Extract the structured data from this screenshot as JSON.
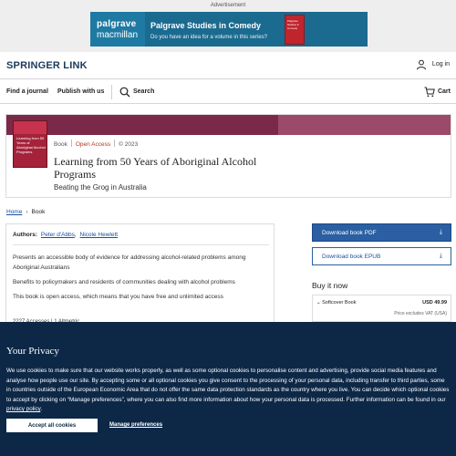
{
  "ad": {
    "label": "Advertisement",
    "brand_line1": "palgrave",
    "brand_line2": "macmillan",
    "title": "Palgrave Studies in Comedy",
    "subtitle": "Do you have an idea for a volume in this series?",
    "book_text": "Palgrave Studies in Comedy",
    "brand_color": "#1b6a8f"
  },
  "header": {
    "logo": "SPRINGER LINK",
    "login_label": "Log in",
    "login_icon": "user-icon"
  },
  "nav": {
    "find_journal": "Find a journal",
    "publish": "Publish with us",
    "search": "Search",
    "cart": "Cart"
  },
  "book": {
    "cover_text": "Learning from 50 Years of Aboriginal Alcohol Programs",
    "type": "Book",
    "access": "Open Access",
    "year": "© 2023",
    "title": "Learning from 50 Years of Aboriginal Alcohol Programs",
    "subtitle": "Beating the Grog in Australia",
    "accent_color": "#7a2a48"
  },
  "breadcrumb": {
    "home": "Home",
    "current": "Book"
  },
  "info": {
    "authors_label": "Authors:",
    "author1": "Peter d'Abbs",
    "author2": "Nicole Hewlett",
    "bullets": [
      "Presents an accessible body of evidence for addressing alcohol-related problems among Aboriginal Australians",
      "Benefits to policymakers and residents of communities dealing with alcohol problems",
      "This book is open access, which means that you have free and unlimited access"
    ],
    "more_text": "2227 Accesses  |  1 Altmetric"
  },
  "sidebar": {
    "download_pdf": "Download book PDF",
    "download_epub": "Download book EPUB",
    "buy_title": "Buy it now",
    "softcover_label": "Softcover Book",
    "softcover_price": "USD 49.99",
    "vat_note": "Price excludes VAT (USA)"
  },
  "privacy": {
    "title": "Your Privacy",
    "body": "We use cookies to make sure that our website works properly, as well as some optional cookies to personalise content and advertising, provide social media features and analyse how people use our site. By accepting some or all optional cookies you give consent to the processing of your personal data, including transfer to third parties, some in countries outside of the European Economic Area that do not offer the same data protection standards as the country where you live. You can decide which optional cookies to accept by clicking on “Manage preferences”, where you can also find more information about how your personal data is processed. Further information can be found in our ",
    "policy_link": "privacy policy",
    "body_end": ".",
    "accept_label": "Accept all cookies",
    "manage_label": "Manage preferences",
    "bg_color": "#0d2847"
  }
}
